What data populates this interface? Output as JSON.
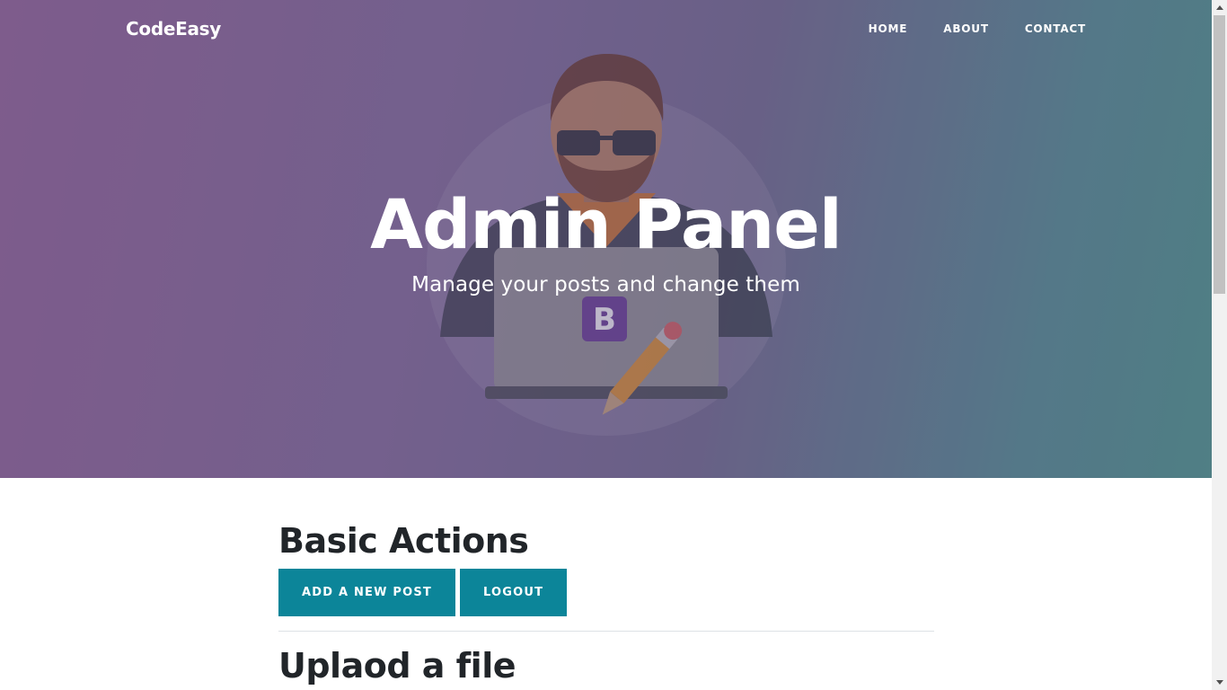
{
  "navbar": {
    "brand": "CodeEasy",
    "links": [
      "HOME",
      "ABOUT",
      "CONTACT"
    ]
  },
  "hero": {
    "title": "Admin Panel",
    "subtitle": "Manage your posts and change them",
    "illustration_badge": "B"
  },
  "sections": {
    "basic_actions": {
      "heading": "Basic Actions",
      "buttons": [
        "ADD A NEW POST",
        "LOGOUT"
      ]
    },
    "upload": {
      "heading": "Uplaod a file"
    }
  },
  "colors": {
    "button": "#0c8599",
    "heading": "#212529",
    "hero_left": "#7f5a8c",
    "hero_right": "#4a8284"
  }
}
